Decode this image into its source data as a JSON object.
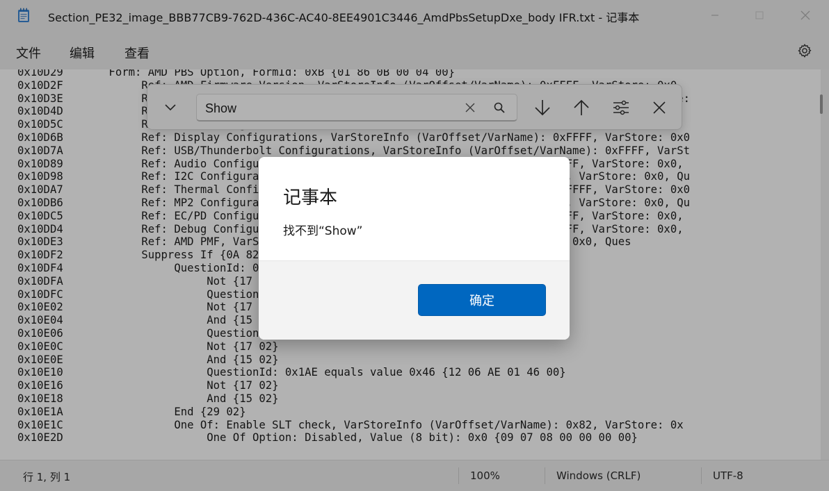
{
  "window": {
    "title": "Section_PE32_image_BBB77CB9-762D-436C-AC40-8EE4901C3446_AmdPbsSetupDxe_body IFR.txt - 记事本"
  },
  "menu": {
    "file": "文件",
    "edit": "编辑",
    "view": "查看"
  },
  "editor": {
    "lines": [
      "0x10D29       Form: AMD PBS Option, FormId: 0xB {01 86 0B 00 04 00}",
      "0x10D2F            Ref: AMD Firmware Version, VarStoreInfo (VarOffset/VarName): 0xFFFF, VarStore: 0x0,",
      "0x10D3E            Ref: AMD Common Platform Module, VarStoreInfo (VarOffset/VarName): 0xFFFF, VarStore:",
      "0x10D4D            Ref: Lane Configurations, VarStoreInfo (VarOffset/VarName): 0xFFFF, VarStore",
      "0x10D5C            Ref: PCIE Configurations, VarStoreInfo (VarOffset/VarName): 0xFFFF, VarStore: 0x0,",
      "0x10D6B            Ref: Display Configurations, VarStoreInfo (VarOffset/VarName): 0xFFFF, VarStore: 0x0",
      "0x10D7A            Ref: USB/Thunderbolt Configurations, VarStoreInfo (VarOffset/VarName): 0xFFFF, VarSt",
      "0x10D89            Ref: Audio Configurations, VarStoreInfo (VarOffset/VarName): 0xFFFF, VarStore: 0x0,",
      "0x10D98            Ref: I2C Configurations, VarStoreInfo (VarOffset/VarName): 0xFFFF, VarStore: 0x0, Qu",
      "0x10DA7            Ref: Thermal Configurations, VarStoreInfo (VarOffset/VarName): 0xFFFF, VarStore: 0x0",
      "0x10DB6            Ref: MP2 Configurations, VarStoreInfo (VarOffset/VarName): 0xFFFF, VarStore: 0x0, Qu",
      "0x10DC5            Ref: EC/PD Configurations, VarStoreInfo (VarOffset/VarName): 0xFFFF, VarStore: 0x0,",
      "0x10DD4            Ref: Debug Configurations, VarStoreInfo (VarOffset/VarName): 0xFFFF, VarStore: 0x0,",
      "0x10DE3            Ref: AMD PMF, VarStoreInfo (VarOffset/VarName): 0xFFFF, VarStore: 0x0, Ques",
      "0x10DF2            Suppress If {0A 82}",
      "0x10DF4                 QuestionId: 0x1AE equals value 0x31 {12 06 AE 01 31 00}",
      "0x10DFA                      Not {17 02}",
      "0x10DFC                      QuestionId: 0x1AE equals value 0x20 {12 06 AE 01 20 00}",
      "0x10E02                      Not {17 02}",
      "0x10E04                      And {15 02}",
      "0x10E06                      QuestionId: 0x1AE equals value 0x45 {12 06 AE 01 45 00}",
      "0x10E0C                      Not {17 02}",
      "0x10E0E                      And {15 02}",
      "0x10E10                      QuestionId: 0x1AE equals value 0x46 {12 06 AE 01 46 00}",
      "0x10E16                      Not {17 02}",
      "0x10E18                      And {15 02}",
      "0x10E1A                 End {29 02}",
      "0x10E1C                 One Of: Enable SLT check, VarStoreInfo (VarOffset/VarName): 0x82, VarStore: 0x",
      "0x10E2D                      One Of Option: Disabled, Value (8 bit): 0x0 {09 07 08 00 00 00 00}"
    ]
  },
  "find": {
    "query": "Show"
  },
  "dialog": {
    "title": "记事本",
    "message": "找不到“Show”",
    "ok_label": "确定"
  },
  "status": {
    "position": "行 1, 列 1",
    "zoom": "100%",
    "line_ending": "Windows (CRLF)",
    "encoding": "UTF-8"
  },
  "colors": {
    "accent": "#0067c0"
  }
}
